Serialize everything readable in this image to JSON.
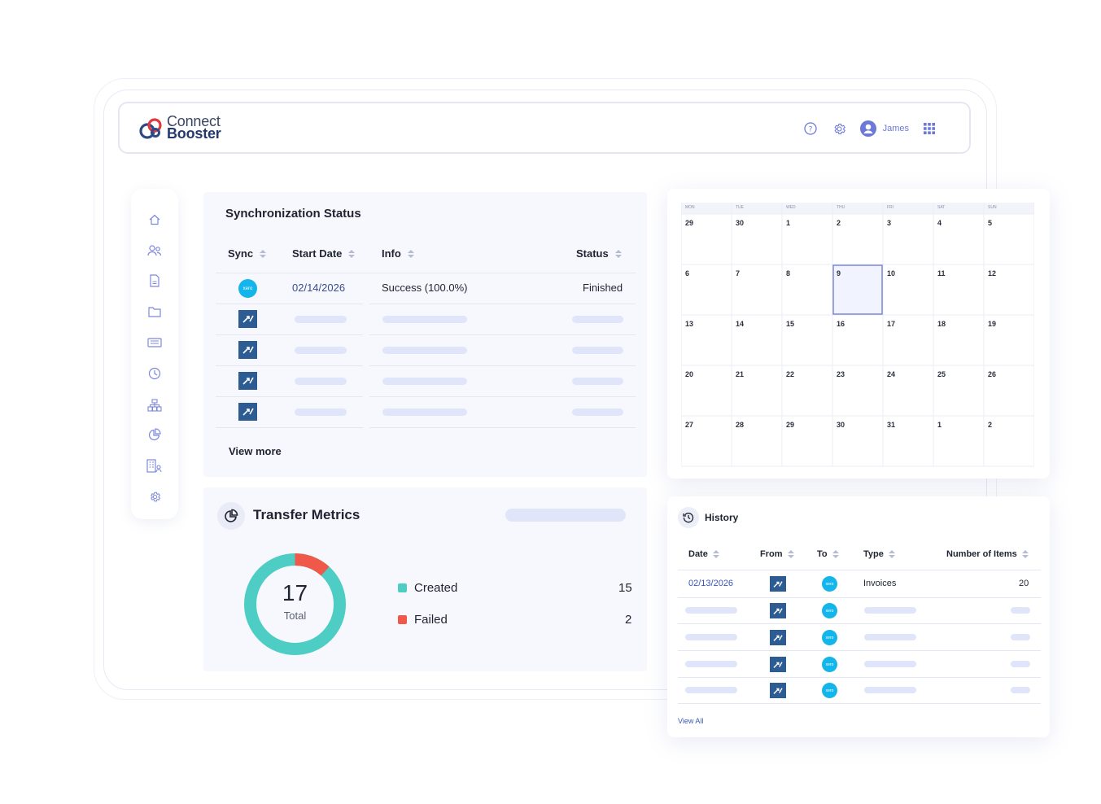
{
  "brand": {
    "line1": "Connect",
    "line2": "Booster"
  },
  "header": {
    "user_name": "James"
  },
  "sidebar": {
    "icons": [
      "home-icon",
      "users-icon",
      "document-icon",
      "folder-icon",
      "ticket-icon",
      "clock-icon",
      "hierarchy-icon",
      "pie-chart-icon",
      "building-user-icon",
      "gear-icon"
    ]
  },
  "sync": {
    "title": "Synchronization Status",
    "columns": [
      "Sync",
      "Start Date",
      "Info",
      "Status"
    ],
    "row": {
      "start_date": "02/14/2026",
      "info": "Success (100.0%)",
      "status": "Finished"
    },
    "view_more": "View more"
  },
  "metrics": {
    "title": "Transfer Metrics",
    "total": "17",
    "total_label": "Total",
    "created_label": "Created",
    "created_value": 15,
    "failed_label": "Failed",
    "failed_value": 2,
    "created_color": "#4ecdc4",
    "failed_color": "#f0584a"
  },
  "calendar": {
    "days": [
      "MON",
      "TUE",
      "WED",
      "THU",
      "FRI",
      "SAT",
      "SUN"
    ],
    "weeks": [
      [
        "29",
        "30",
        "1",
        "2",
        "3",
        "4",
        "5"
      ],
      [
        "6",
        "7",
        "8",
        "9",
        "10",
        "11",
        "12"
      ],
      [
        "13",
        "14",
        "15",
        "16",
        "17",
        "18",
        "19"
      ],
      [
        "20",
        "21",
        "22",
        "23",
        "24",
        "25",
        "26"
      ],
      [
        "27",
        "28",
        "29",
        "30",
        "31",
        "1",
        "2"
      ]
    ],
    "selected": "9"
  },
  "history": {
    "title": "History",
    "columns": [
      "Date",
      "From",
      "To",
      "Type",
      "Number of Items"
    ],
    "row": {
      "date": "02/13/2026",
      "type": "Invoices",
      "count": "20"
    },
    "view_all": "View All"
  },
  "colors": {
    "accent": "#6c79d9",
    "xero": "#13b5ea",
    "qbo": "#2d5c93",
    "placeholder": "#e1e5fa"
  }
}
